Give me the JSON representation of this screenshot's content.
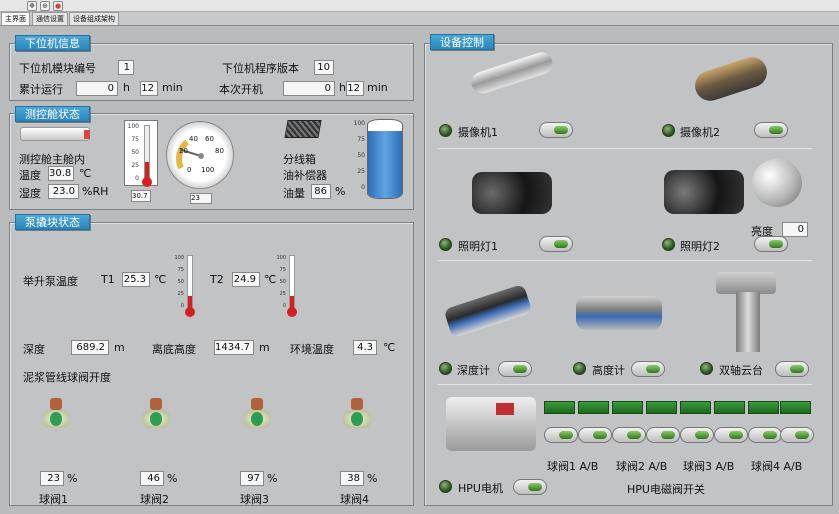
{
  "tabs": [
    "主界面",
    "通信设置",
    "设备组成架构"
  ],
  "colors": {
    "accent": "#2b86ba",
    "led": "#3c6a2c",
    "tank": "#3e86d0"
  },
  "lower": {
    "title": "下位机信息",
    "module_label": "下位机模块编号",
    "module_value": "1",
    "version_label": "下位机程序版本",
    "version_value": "10",
    "runtime_label": "累计运行",
    "rt_h": "0",
    "h": "h",
    "rt_min": "12",
    "min": "min",
    "boot_label": "本次开机",
    "bt_h": "0",
    "bt_min": "12"
  },
  "cabin": {
    "title": "测控舱状态",
    "main_label": "测控舱主舱内",
    "temp_label": "温度",
    "temp_value": "30.8",
    "temp_unit": "℃",
    "hum_label": "湿度",
    "hum_value": "23.0",
    "hum_unit": "%RH",
    "therm_readout": "30.7",
    "gauge_readout": "23",
    "junction_label": "分线箱",
    "comp_label": "油补偿器",
    "oil_label": "油量",
    "oil_value": "86",
    "oil_unit": "%",
    "therm_level": 0.31,
    "gauge_value": 23,
    "tank_level": 0.86
  },
  "pump": {
    "title": "泵撬块状态",
    "lift_label": "举升泵温度",
    "t1_label": "T1",
    "t1_value": "25.3",
    "t2_label": "T2",
    "t2_value": "24.9",
    "deg": "℃",
    "t1_level": 0.25,
    "t2_level": 0.25,
    "depth_label": "深度",
    "depth_value": "689.2",
    "m": "m",
    "alt_label": "离底高度",
    "alt_value": "1434.7",
    "env_label": "环境温度",
    "env_value": "4.3",
    "pipe_label": "泥浆管线球阀开度",
    "pct": "%",
    "valves": [
      {
        "label": "球阀1",
        "value": "23"
      },
      {
        "label": "球阀2",
        "value": "46"
      },
      {
        "label": "球阀3",
        "value": "97"
      },
      {
        "label": "球阀4",
        "value": "38"
      }
    ]
  },
  "control": {
    "title": "设备控制",
    "camera1": "摄像机1",
    "camera2": "摄像机2",
    "light1": "照明灯1",
    "light2": "照明灯2",
    "brightness_label": "亮度",
    "brightness_value": "0",
    "depth_meter": "深度计",
    "altimeter": "高度计",
    "pan_tilt": "双轴云台",
    "hpu_label": "HPU电机",
    "valve_labels": [
      "球阀1 A/B",
      "球阀2 A/B",
      "球阀3 A/B",
      "球阀4 A/B"
    ],
    "solenoid_label": "HPU电磁阀开关"
  },
  "scale_labels": [
    "100",
    "75",
    "50",
    "25",
    "0"
  ],
  "gauge_ticks": [
    "20",
    "40",
    "60",
    "80",
    "0",
    "100"
  ]
}
